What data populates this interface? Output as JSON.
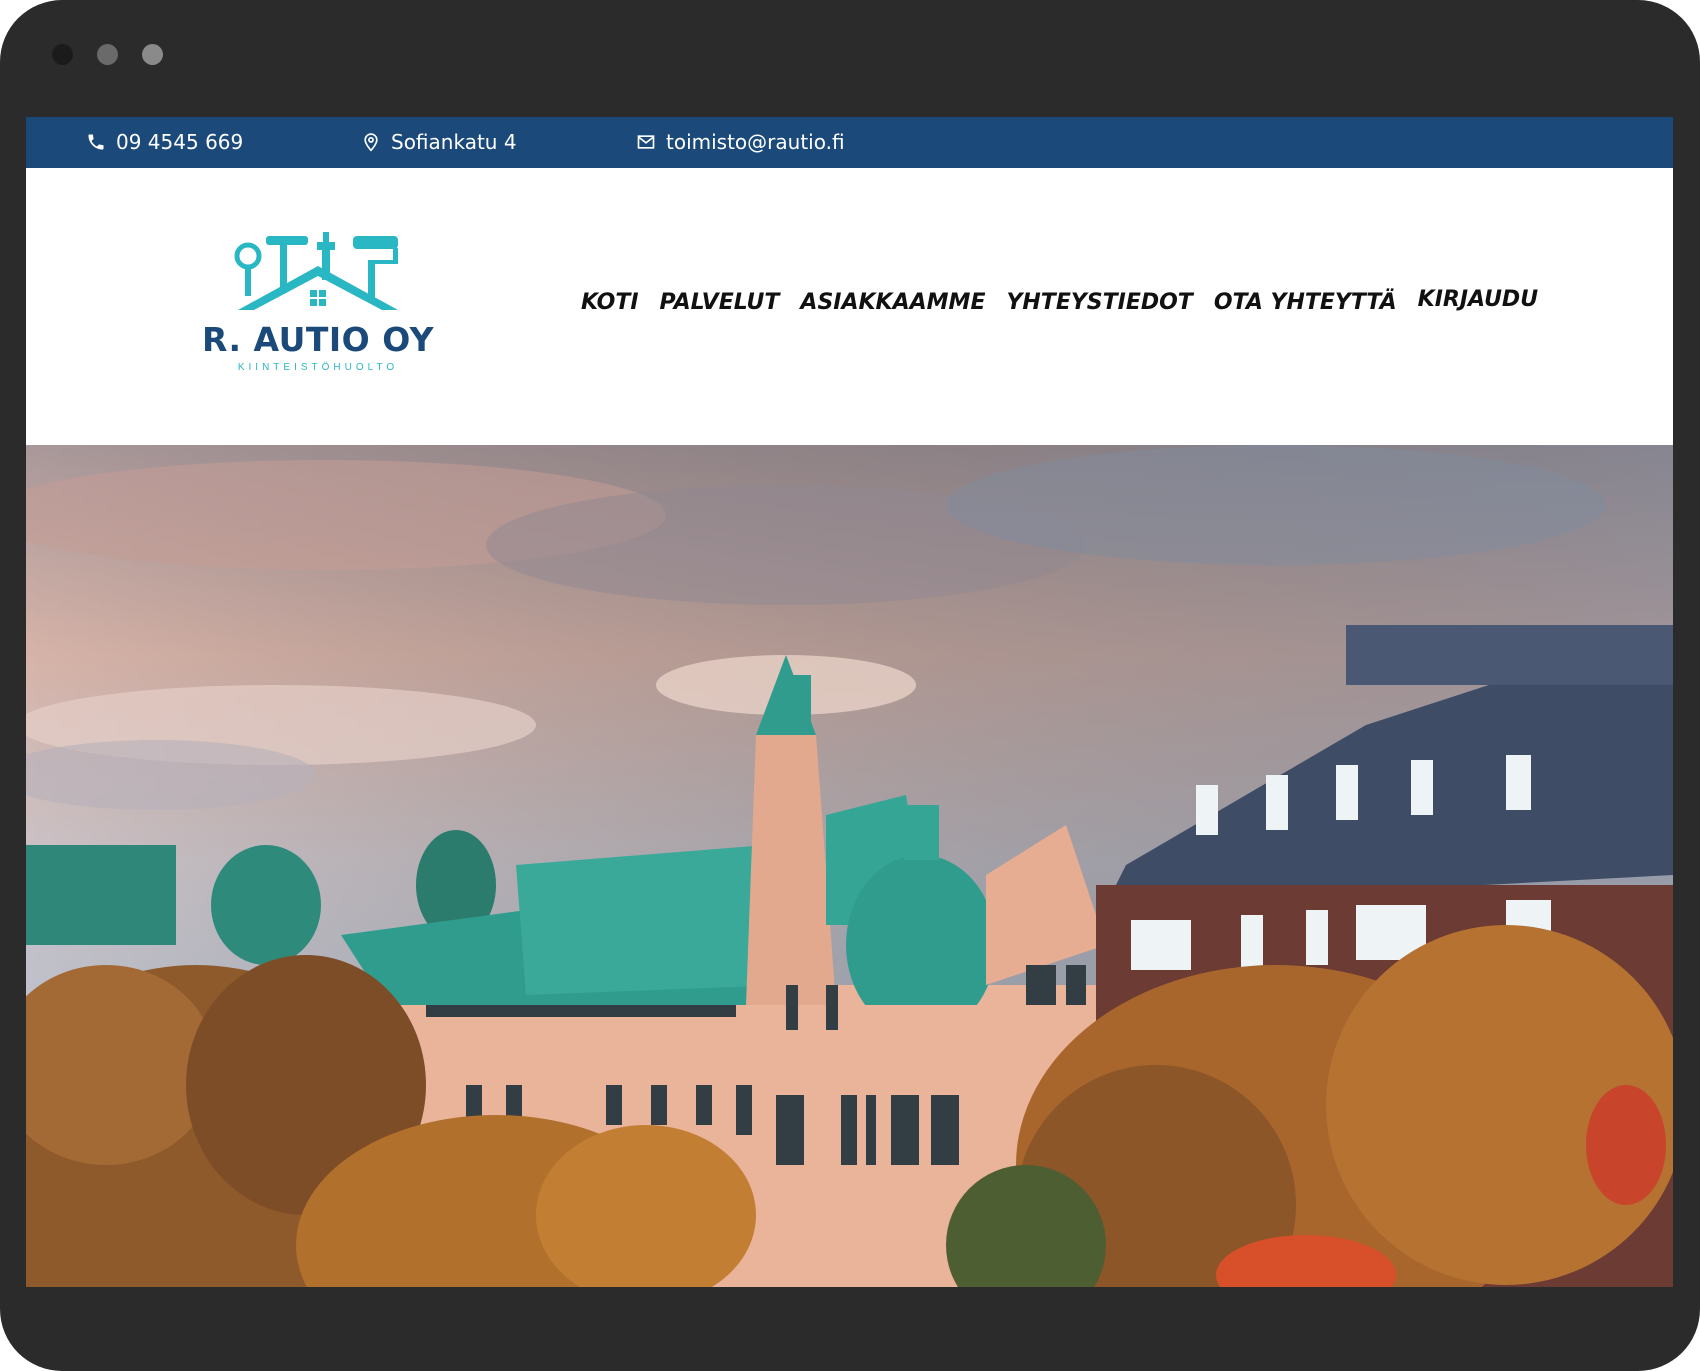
{
  "topbar": {
    "phone": {
      "icon": "phone-icon",
      "text": "09 4545 669"
    },
    "address": {
      "icon": "location-pin-icon",
      "text": "Sofiankatu 4"
    },
    "email": {
      "icon": "mail-icon",
      "text": "toimisto@rautio.fi"
    }
  },
  "logo": {
    "name": "R. AUTIO OY",
    "tagline": "KIINTEISTÖHUOLTO",
    "icon": "house-tools-logo-icon"
  },
  "nav": {
    "items": [
      {
        "label": "KOTI"
      },
      {
        "label": "PALVELUT"
      },
      {
        "label": "ASIAKKAAMME"
      },
      {
        "label": "YHTEYSTIEDOT"
      },
      {
        "label": "OTA YHTEYTTÄ"
      },
      {
        "label": "KIRJAUDU"
      }
    ]
  },
  "colors": {
    "topbar": "#1b4a7a",
    "logo_primary": "#2ab7c4",
    "logo_text": "#1b4a7a",
    "frame": "#2b2b2b"
  }
}
